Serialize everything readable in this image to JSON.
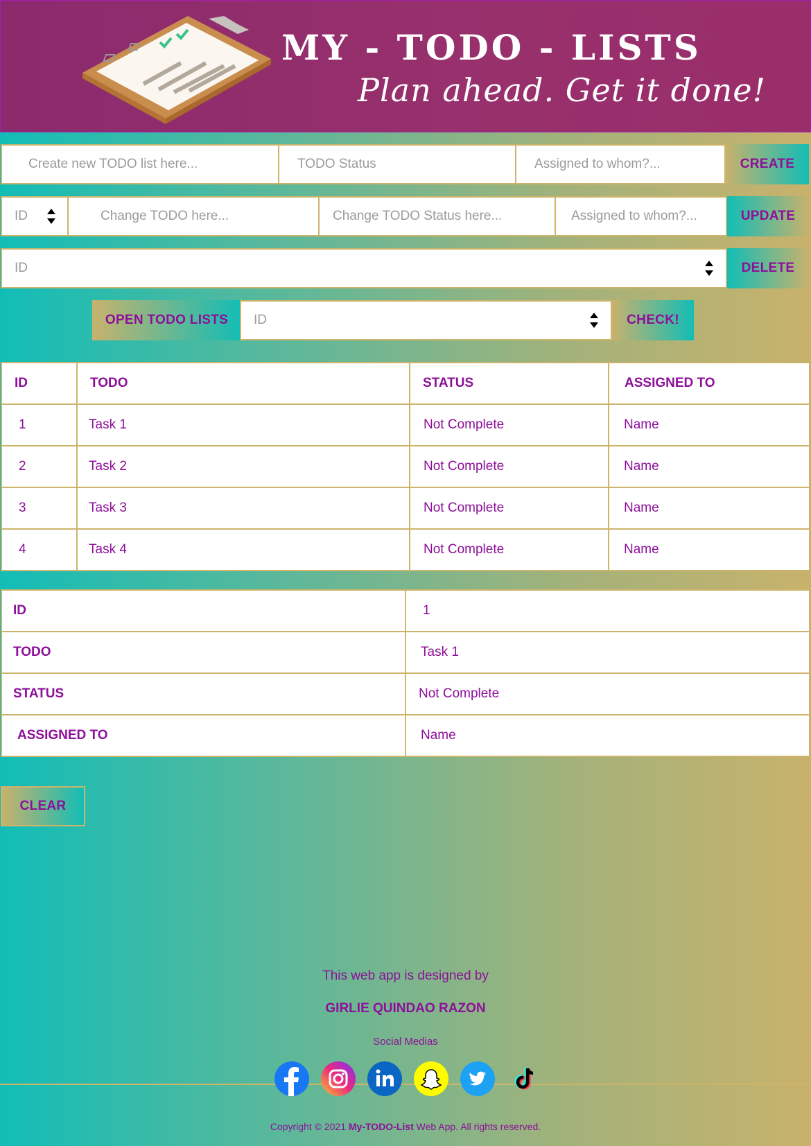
{
  "header": {
    "title": "MY - TODO - LISTS",
    "tagline": "Plan ahead. Get it done!"
  },
  "create_row": {
    "todo_placeholder": "Create new TODO list here...",
    "status_placeholder": "TODO Status",
    "assigned_placeholder": "Assigned to whom?...",
    "button_label": "CREATE"
  },
  "update_row": {
    "id_placeholder": "ID",
    "todo_placeholder": "Change TODO here...",
    "status_placeholder": "Change TODO Status here...",
    "assigned_placeholder": "Assigned to whom?...",
    "button_label": "UPDATE"
  },
  "delete_row": {
    "id_placeholder": "ID",
    "button_label": "DELETE"
  },
  "check_row": {
    "open_label": "OPEN TODO LISTS",
    "id_placeholder": "ID",
    "check_label": "CHECK!"
  },
  "todo_table": {
    "headers": [
      "ID",
      "TODO",
      "STATUS",
      "ASSIGNED TO"
    ],
    "rows": [
      [
        "1",
        "Task 1",
        "Not Complete",
        "Name"
      ],
      [
        "2",
        "Task 2",
        "Not Complete",
        "Name"
      ],
      [
        "3",
        "Task 3",
        "Not Complete",
        "Name"
      ],
      [
        "4",
        "Task 4",
        "Not Complete",
        "Name"
      ]
    ]
  },
  "detail_table": {
    "rows": [
      [
        "ID",
        "1"
      ],
      [
        "TODO",
        "Task 1"
      ],
      [
        "STATUS",
        "Not Complete"
      ],
      [
        "ASSIGNED TO",
        "Name"
      ]
    ]
  },
  "clear_label": "CLEAR",
  "footer": {
    "designed_by": "This web app is designed by",
    "author": "GIRLIE QUINDAO RAZON",
    "social_heading": "Social Medias",
    "copyright_prefix": "Copyright © 2021 ",
    "copyright_brand": "My-TODO-List",
    "copyright_suffix": " Web App. All rights reserved."
  },
  "social_icons": [
    "facebook-icon",
    "instagram-icon",
    "linkedin-icon",
    "snapchat-icon",
    "twitter-icon",
    "tiktok-icon"
  ],
  "colors": {
    "accent": "#8d0f9a",
    "border": "#cdb46a",
    "header_bg": "#8b2a6d",
    "gradient_start": "#12bdb6",
    "gradient_end": "#c8b26c"
  }
}
